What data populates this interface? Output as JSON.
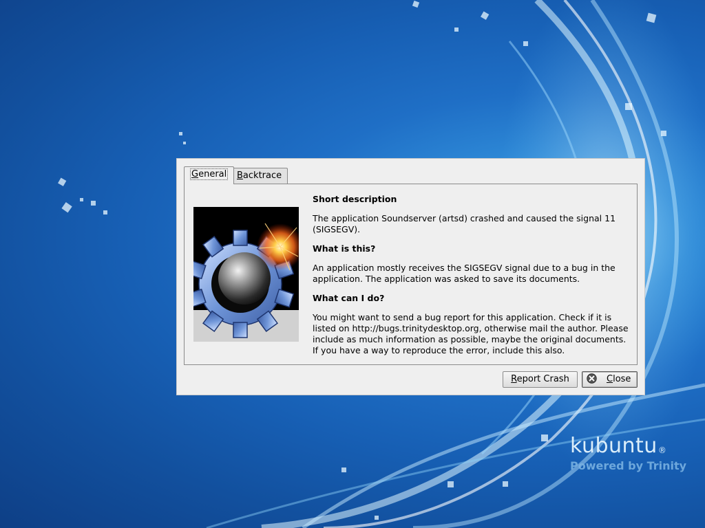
{
  "desktop": {
    "brand_name": "kubuntu",
    "brand_mark": "®",
    "brand_tagline": "Powered by Trinity"
  },
  "dialog": {
    "tabs": [
      {
        "label_first": "G",
        "label_rest": "eneral",
        "active": true
      },
      {
        "label_first": "B",
        "label_rest": "acktrace",
        "active": false
      }
    ],
    "sections": {
      "short_description_heading": "Short description",
      "short_description_text": "The application Soundserver (artsd) crashed and caused the signal 11 (SIGSEGV).",
      "what_is_heading": "What is this?",
      "what_is_text": "An application mostly receives the SIGSEGV signal due to a bug in the application. The application was asked to save its documents.",
      "what_can_heading": "What can I do?",
      "what_can_text": "You might want to send a bug report for this application. Check if it is listed on http://bugs.trinitydesktop.org, otherwise mail the author. Please include as much information as possible, maybe the original documents. If you have a way to reproduce the error, include this also."
    },
    "buttons": {
      "report_first": "R",
      "report_rest": "eport Crash",
      "close_first": "C",
      "close_rest": "lose"
    },
    "icons": {
      "crash_image": "gear-bomb-icon",
      "close": "close-icon"
    }
  }
}
